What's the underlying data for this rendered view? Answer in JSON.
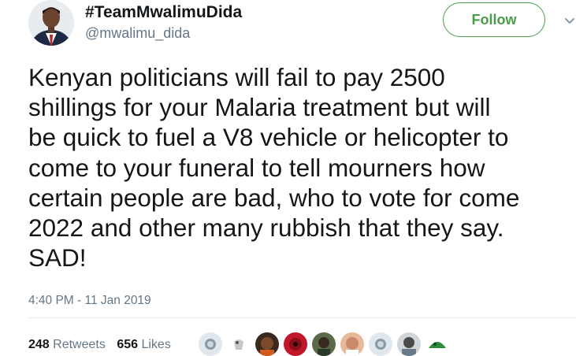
{
  "author": {
    "display_name": "#TeamMwalimuDida",
    "handle": "@mwalimu_dida"
  },
  "actions": {
    "follow_label": "Follow",
    "menu_icon": "chevron-down-icon"
  },
  "tweet": {
    "text": "Kenyan politicians will fail to pay 2500\nshillings for your Malaria treatment but will\nbe quick to fuel a V8 vehicle or helicopter to\ncome to your funeral to tell mourners how\ncertain people are bad, who to vote for come\n2022 and other many rubbish that they say.\nSAD!",
    "timestamp": "4:40 PM - 11 Jan 2019"
  },
  "stats": {
    "retweets_count": "248",
    "retweets_label": "Retweets",
    "likes_count": "656",
    "likes_label": "Likes"
  },
  "colors": {
    "follow_accent": "#4a9c4a",
    "secondary_text": "#657786",
    "primary_text": "#14171a"
  }
}
